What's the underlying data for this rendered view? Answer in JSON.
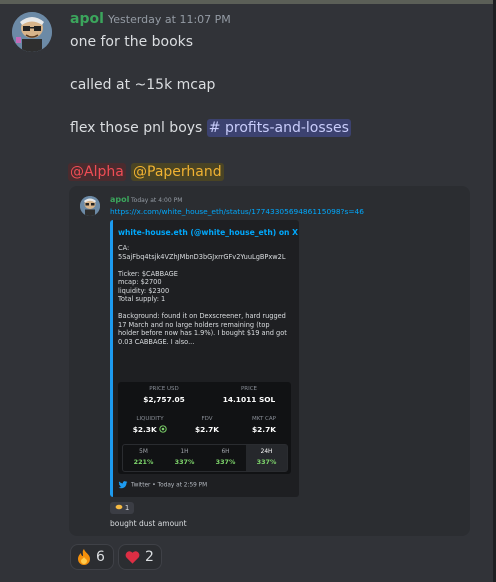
{
  "message": {
    "author": "apol",
    "timestamp": "Yesterday at 11:07 PM",
    "lines": {
      "l1": "one for the books",
      "l2": "called at ~15k mcap",
      "l3_prefix": "flex those pnl boys ",
      "channel": "# profits-and-losses"
    },
    "mentions": [
      "@Alpha",
      "@Paperhand"
    ]
  },
  "reply": {
    "author": "apol",
    "timestamp": "Today at 4:00 PM",
    "link": "https://x.com/white_house_eth/status/1774330569486115098?s=46",
    "embed": {
      "title": "white-house.eth (@white_house_eth) on X",
      "body": "CA:\n5SajFbq4tsjk4VZhJMbnD3bGJxrrGFv2YuuLgBPxw2L\n\nTicker: $CABBAGE\nmcap: $2700\nliquidity: $2300\nTotal supply: 1\n\nBackground: found it on Dexscreener, hard rugged 17 March and no large holders remaining (top holder before now has 1.9%). I bought $19 and got 0.03 CABBAGE. I also...",
      "stats": {
        "price_usd_label": "PRICE USD",
        "price_usd": "$2,757.05",
        "price_label": "PRICE",
        "price": "14.1011 SOL",
        "liquidity_label": "LIQUIDITY",
        "liquidity": "$2.3K",
        "fdv_label": "FDV",
        "fdv": "$2.7K",
        "mktcap_label": "MKT CAP",
        "mktcap": "$2.7K"
      },
      "timeframes": [
        {
          "label": "5M",
          "value": "221%"
        },
        {
          "label": "1H",
          "value": "337%"
        },
        {
          "label": "6H",
          "value": "337%"
        },
        {
          "label": "24H",
          "value": "337%"
        }
      ],
      "footer": "Twitter • Today at 2:59 PM"
    },
    "reaction_count": "1",
    "text": "bought dust amount"
  },
  "reactions": [
    {
      "icon": "fire-icon",
      "count": "6"
    },
    {
      "icon": "heart-icon",
      "count": "2"
    }
  ]
}
